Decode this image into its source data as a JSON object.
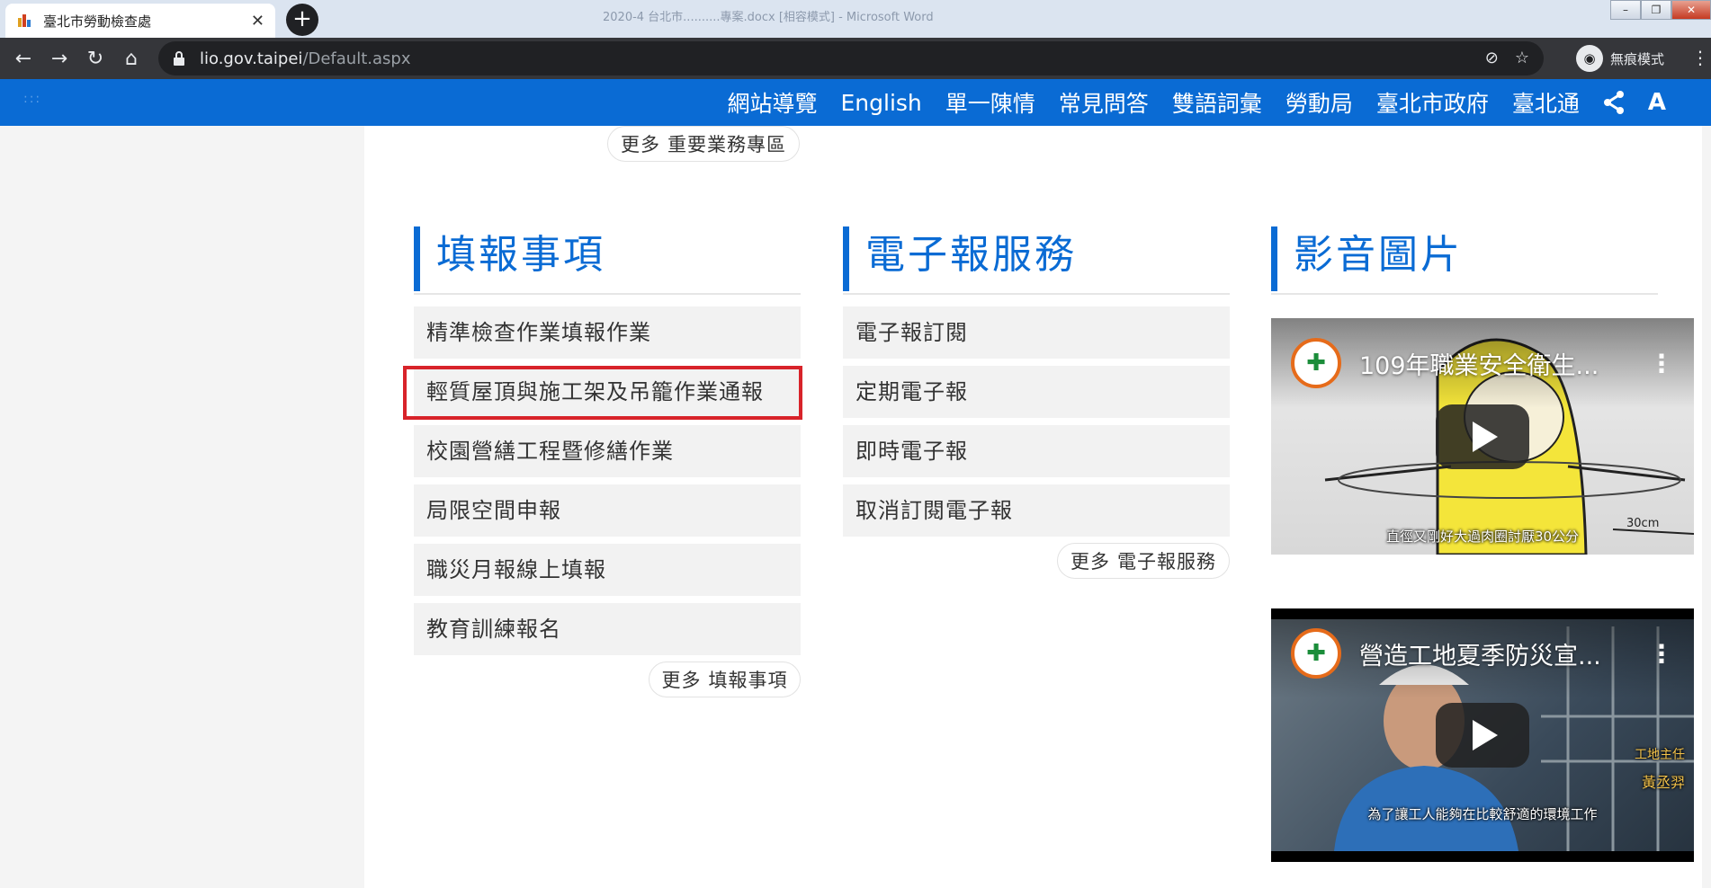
{
  "browser": {
    "tab_title": "臺北市勞動檢查處",
    "tab_close": "✕",
    "new_tab": "+",
    "bg_window_title": "2020-4 台北市..........專案.docx [相容模式] - Microsoft Word",
    "url_host": "lio.gov.taipei",
    "url_path": "/Default.aspx",
    "incognito_label": "無痕模式"
  },
  "site_nav": {
    "items": [
      "網站導覽",
      "English",
      "單一陳情",
      "常見問答",
      "雙語詞彙",
      "勞動局",
      "臺北市政府",
      "臺北通"
    ],
    "share_icon": "share-icon",
    "font_icon": "A"
  },
  "top_more": {
    "prefix": "更多",
    "label": "重要業務專區"
  },
  "sections": {
    "forms": {
      "title": "填報事項",
      "items": [
        "精準檢查作業填報作業",
        "輕質屋頂與施工架及吊籠作業通報",
        "校園營繕工程暨修繕作業",
        "局限空間申報",
        "職災月報線上填報",
        "教育訓練報名"
      ],
      "more_prefix": "更多",
      "more_label": "填報事項"
    },
    "enews": {
      "title": "電子報服務",
      "items": [
        "電子報訂閱",
        "定期電子報",
        "即時電子報",
        "取消訂閱電子報"
      ],
      "more_prefix": "更多",
      "more_label": "電子報服務"
    },
    "media": {
      "title": "影音圖片",
      "videos": [
        {
          "title": "109年職業安全衛生...",
          "caption": "直徑又剛好大過肉圈討厭30公分"
        },
        {
          "title": "營造工地夏季防災宣...",
          "caption": "為了讓工人能夠在比較舒適的環境工作",
          "sub1": "工地主任",
          "sub2": "黃丞羿"
        }
      ]
    }
  },
  "colors": {
    "brand_blue": "#0a6bd4",
    "highlight_red": "#d8232a"
  }
}
